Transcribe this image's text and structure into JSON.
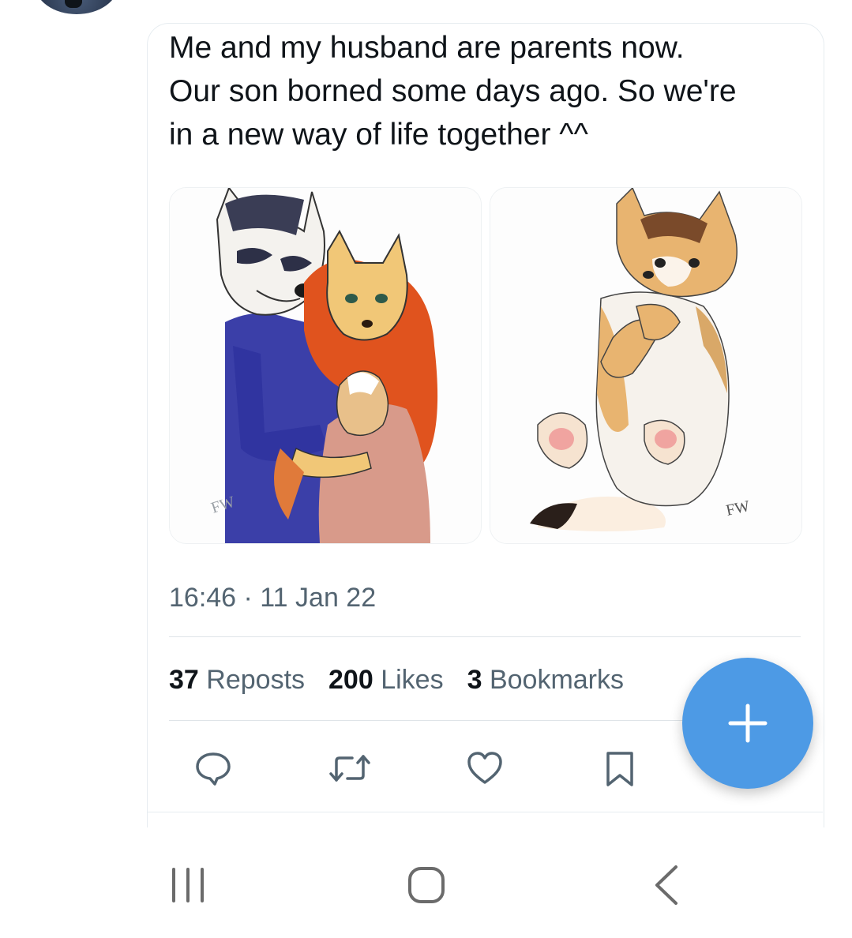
{
  "tweet": {
    "text": "Me and my husband are parents now.\nOur son borned some days ago. So we're\nin a new way of life together ^^",
    "timestamp": "16:46 · 11 Jan 22",
    "media": [
      {
        "description_icon": "artwork-image",
        "signature": "FW"
      },
      {
        "description_icon": "artwork-image",
        "signature": "FW"
      }
    ]
  },
  "stats": {
    "reposts_count": "37",
    "reposts_label": "Reposts",
    "likes_count": "200",
    "likes_label": "Likes",
    "bookmarks_count": "3",
    "bookmarks_label": "Bookmarks"
  },
  "actions": [
    "reply-icon",
    "repost-icon",
    "like-icon",
    "bookmark-icon"
  ],
  "fab": {
    "icon": "plus-icon",
    "color": "#4d9ae5"
  },
  "colors": {
    "text": "#0f1419",
    "secondary": "#536471",
    "icon": "#536471",
    "accent": "#4d9ae5"
  },
  "system_nav": [
    "recent-apps-icon",
    "home-icon",
    "back-icon"
  ]
}
